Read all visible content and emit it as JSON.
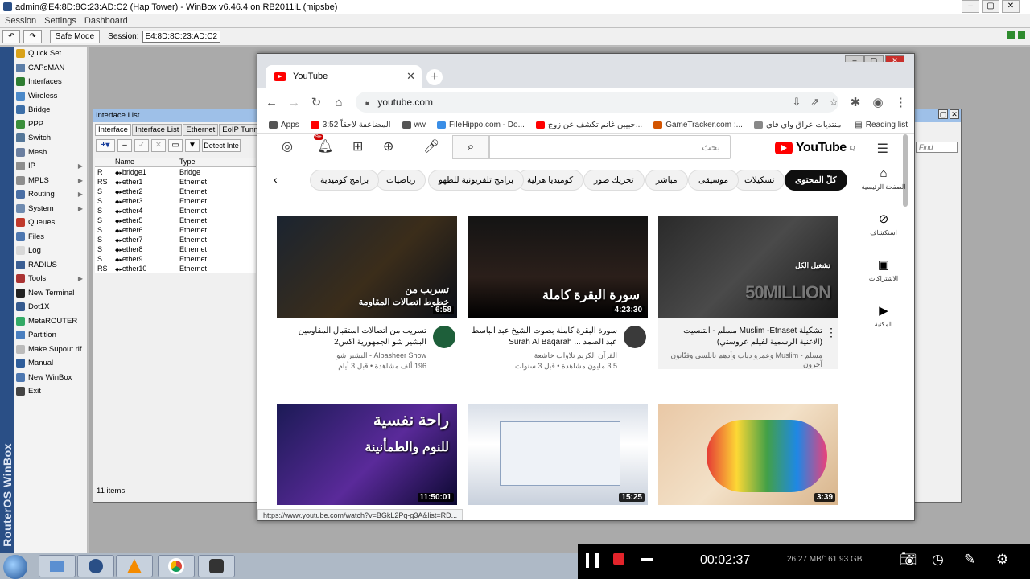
{
  "winbox": {
    "title": "admin@E4:8D:8C:23:AD:C2 (Hap Tower) - WinBox v6.46.4 on RB2011iL (mipsbe)",
    "menu": [
      "Session",
      "Settings",
      "Dashboard"
    ],
    "safe_mode": "Safe Mode",
    "session_label": "Session:",
    "session_value": "E4:8D:8C:23:AD:C2",
    "brand": "RouterOS WinBox",
    "nav": [
      {
        "label": "Quick Set",
        "color": "#d9a21a",
        "arrow": false
      },
      {
        "label": "CAPsMAN",
        "color": "#5c7ea8",
        "arrow": false
      },
      {
        "label": "Interfaces",
        "color": "#2e7d32",
        "arrow": false
      },
      {
        "label": "Wireless",
        "color": "#4b89c9",
        "arrow": false
      },
      {
        "label": "Bridge",
        "color": "#3d6fa8",
        "arrow": false
      },
      {
        "label": "PPP",
        "color": "#3b8f3b",
        "arrow": false
      },
      {
        "label": "Switch",
        "color": "#557799",
        "arrow": false
      },
      {
        "label": "Mesh",
        "color": "#6b7fa0",
        "arrow": false
      },
      {
        "label": "IP",
        "color": "#8e8e8e",
        "arrow": true
      },
      {
        "label": "MPLS",
        "color": "#8e8e8e",
        "arrow": true
      },
      {
        "label": "Routing",
        "color": "#4a6fa5",
        "arrow": true
      },
      {
        "label": "System",
        "color": "#6f8bb0",
        "arrow": true
      },
      {
        "label": "Queues",
        "color": "#c0392b",
        "arrow": false
      },
      {
        "label": "Files",
        "color": "#4d77b0",
        "arrow": false
      },
      {
        "label": "Log",
        "color": "#d8d8d8",
        "arrow": false
      },
      {
        "label": "RADIUS",
        "color": "#3b5f94",
        "arrow": false
      },
      {
        "label": "Tools",
        "color": "#a33",
        "arrow": true
      },
      {
        "label": "New Terminal",
        "color": "#222",
        "arrow": false
      },
      {
        "label": "Dot1X",
        "color": "#355a8f",
        "arrow": false
      },
      {
        "label": "MetaROUTER",
        "color": "#3a6",
        "arrow": false
      },
      {
        "label": "Partition",
        "color": "#4a7fbf",
        "arrow": false
      },
      {
        "label": "Make Supout.rif",
        "color": "#bbb",
        "arrow": false
      },
      {
        "label": "Manual",
        "color": "#2f5d9a",
        "arrow": false
      },
      {
        "label": "New WinBox",
        "color": "#4d77b0",
        "arrow": false
      },
      {
        "label": "Exit",
        "color": "#444",
        "arrow": false
      }
    ],
    "interface_list": {
      "title": "Interface List",
      "tabs": [
        "Interface",
        "Interface List",
        "Ethernet",
        "EoIP Tunnel"
      ],
      "detect_label": "Detect Inte",
      "find_placeholder": "Find",
      "columns": [
        "",
        "Name",
        "Type"
      ],
      "rows": [
        {
          "flag": "R",
          "name": "bridge1",
          "type": "Bridge"
        },
        {
          "flag": "RS",
          "name": "ether1",
          "type": "Ethernet"
        },
        {
          "flag": "S",
          "name": "ether2",
          "type": "Ethernet"
        },
        {
          "flag": "S",
          "name": "ether3",
          "type": "Ethernet"
        },
        {
          "flag": "S",
          "name": "ether4",
          "type": "Ethernet"
        },
        {
          "flag": "S",
          "name": "ether5",
          "type": "Ethernet"
        },
        {
          "flag": "S",
          "name": "ether6",
          "type": "Ethernet"
        },
        {
          "flag": "S",
          "name": "ether7",
          "type": "Ethernet"
        },
        {
          "flag": "S",
          "name": "ether8",
          "type": "Ethernet"
        },
        {
          "flag": "S",
          "name": "ether9",
          "type": "Ethernet"
        },
        {
          "flag": "RS",
          "name": "ether10",
          "type": "Ethernet"
        }
      ],
      "status": "11 items"
    }
  },
  "chrome": {
    "tab_title": "YouTube",
    "url": "youtube.com",
    "bookmarks": [
      {
        "label": "Apps",
        "color": "#555"
      },
      {
        "label": "3:52 المضاعفة لاحقاً",
        "color": "#f00"
      },
      {
        "label": "ww",
        "color": "#555"
      },
      {
        "label": "FileHippo.com - Do...",
        "color": "#3a8ee6"
      },
      {
        "label": "حبيبن غانم تكشف عن زوج...",
        "color": "#f00"
      },
      {
        "label": "GameTracker.com :...",
        "color": "#d35400"
      },
      {
        "label": "منتديات عراق واي فاي",
        "color": "#888"
      }
    ],
    "reading_list": "Reading list",
    "status_url": "https://www.youtube.com/watch?v=BGkL2Pq-g3A&list=RD..."
  },
  "youtube": {
    "logo": "YouTube",
    "logo_sup": "IQ",
    "search_placeholder": "بحث",
    "chips": [
      "كلّ المحتوى",
      "تشكيلات",
      "موسيقى",
      "مباشر",
      "تحريك صور",
      "كوميديا هزلية",
      "برامج تلفزيونية للطهو",
      "رياضيات",
      "برامج كوميدية"
    ],
    "sidebar": [
      {
        "glyph": "⌂",
        "label": "الصفحة الرئيسية"
      },
      {
        "glyph": "⊘",
        "label": "استكشاف"
      },
      {
        "glyph": "▣",
        "label": "الاشتراكات"
      },
      {
        "glyph": "▶",
        "label": "المكتبة"
      }
    ],
    "videos": [
      {
        "title": "تسريب من اتصالات استقبال المقاومين | البشير شو الجمهورية اكس2",
        "channel": "Albasheer Show - البشير شو",
        "stats": "196 ألف مشاهدة • قبل 3 أيام",
        "duration": "6:58",
        "overlay1": "تسريب من",
        "overlay2": "خطوط اتصالات المقاومة",
        "avatar": "#1e5f3a"
      },
      {
        "title": "سورة البقرة كاملة بصوت الشيخ عبد الباسط عبد الصمد ... Surah Al Baqarah",
        "channel": "القرآن الكريم تلاوات خاشعة",
        "stats": "3.5 مليون مشاهدة • قبل 3 سنوات",
        "duration": "4:23:30",
        "overlay1": "سورة البقرة كاملة",
        "overlay2": "",
        "avatar": "#3a3a3a"
      },
      {
        "title": "تشكيلة Muslim -Etnaset مسلم - التنسيت (الاغنية الرسمية لفيلم عروستي)",
        "channel": "مسلم - Muslim وعمرو دياب وأدهم نابلسي وفنّانون آخرون",
        "stats": "",
        "duration": "",
        "overlay1": "تشغيل الكل",
        "overlay2": "50MILLION",
        "avatar": ""
      },
      {
        "title": "",
        "channel": "",
        "stats": "",
        "duration": "11:50:01",
        "overlay1": "راحة نفسية",
        "overlay2": "للنوم والطمأنينة",
        "avatar": ""
      },
      {
        "title": "",
        "channel": "",
        "stats": "",
        "duration": "15:25",
        "overlay1": "",
        "overlay2": "",
        "avatar": ""
      },
      {
        "title": "",
        "channel": "",
        "stats": "",
        "duration": "3:39",
        "overlay1": "",
        "overlay2": "",
        "avatar": ""
      }
    ]
  },
  "recorder": {
    "time": "00:02:37",
    "size": "26.27 MB/161.93 GB"
  },
  "colors": {
    "yt_red": "#ff0000",
    "winbox_blue": "#2a4f86",
    "rec_stop": "#e3242b"
  }
}
